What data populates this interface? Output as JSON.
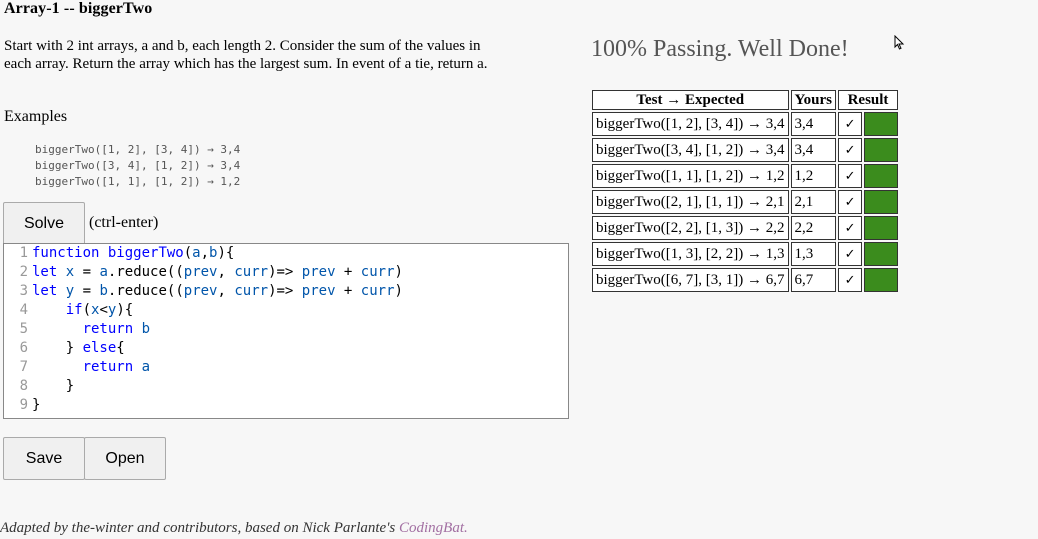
{
  "title": "Array-1 -- biggerTwo",
  "description": "Start with 2 int arrays, a and b, each length 2. Consider the sum of the values in each array. Return the array which has the largest sum. In event of a tie, return a.",
  "examples_label": "Examples",
  "examples": [
    "biggerTwo([1, 2], [3, 4]) → 3,4",
    "biggerTwo([3, 4], [1, 2]) → 3,4",
    "biggerTwo([1, 1], [1, 2]) → 1,2"
  ],
  "solve": {
    "label": "Solve",
    "hint": "(ctrl-enter)"
  },
  "editor": {
    "line_numbers": [
      "1",
      "2",
      "3",
      "4",
      "5",
      "6",
      "7",
      "8",
      "9"
    ]
  },
  "buttons": {
    "save": "Save",
    "open": "Open"
  },
  "footer": {
    "text": "Adapted by the-winter and contributors, based on Nick Parlante's ",
    "link": "CodingBat."
  },
  "status": "100% Passing. Well Done!",
  "results": {
    "headers": {
      "test": "Test → Expected",
      "yours": "Yours",
      "result": "Result"
    },
    "rows": [
      {
        "test": "biggerTwo([1, 2], [3, 4]) → 3,4",
        "yours": "3,4",
        "check": "✓"
      },
      {
        "test": "biggerTwo([3, 4], [1, 2]) → 3,4",
        "yours": "3,4",
        "check": "✓"
      },
      {
        "test": "biggerTwo([1, 1], [1, 2]) → 1,2",
        "yours": "1,2",
        "check": "✓"
      },
      {
        "test": "biggerTwo([2, 1], [1, 1]) → 2,1",
        "yours": "2,1",
        "check": "✓"
      },
      {
        "test": "biggerTwo([2, 2], [1, 3]) → 2,2",
        "yours": "2,2",
        "check": "✓"
      },
      {
        "test": "biggerTwo([1, 3], [2, 2]) → 1,3",
        "yours": "1,3",
        "check": "✓"
      },
      {
        "test": "biggerTwo([6, 7], [3, 1]) → 6,7",
        "yours": "6,7",
        "check": "✓"
      }
    ]
  },
  "colors": {
    "pass": "#3b8c1d",
    "link": "#a26fa2"
  }
}
